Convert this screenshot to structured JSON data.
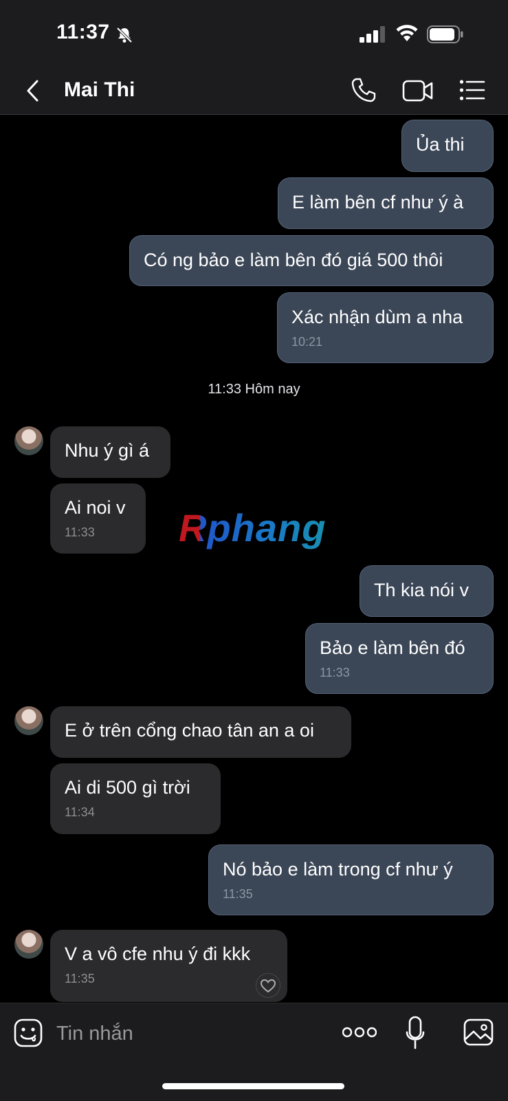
{
  "status_bar": {
    "time": "11:37",
    "battery_level": 0.9
  },
  "header": {
    "title": "Mai Thi"
  },
  "date_separator": "11:33 Hôm nay",
  "messages": [
    {
      "dir": "out",
      "text": "Ủa thi"
    },
    {
      "dir": "out",
      "text": "E làm bên cf như ý à"
    },
    {
      "dir": "out",
      "text": "Có ng bảo e làm bên đó giá 500 thôi"
    },
    {
      "dir": "out",
      "text": "Xác nhận dùm a nha",
      "time": "10:21"
    },
    {
      "dir": "in",
      "text": "Nhu ý gì á"
    },
    {
      "dir": "in",
      "text": "Ai noi v",
      "time": "11:33"
    },
    {
      "dir": "out",
      "text": "Th kia nói v"
    },
    {
      "dir": "out",
      "text": "Bảo e làm bên đó",
      "time": "11:33"
    },
    {
      "dir": "in",
      "text": "E ở trên cổng chao tân an a oi"
    },
    {
      "dir": "in",
      "text": "Ai di 500 gì trời",
      "time": "11:34"
    },
    {
      "dir": "out",
      "text": "Nó bảo e làm trong cf như ý",
      "time": "11:35"
    },
    {
      "dir": "in",
      "text": "V a vô cfe nhu ý đi kkk",
      "time": "11:35"
    }
  ],
  "watermark": "Rphang",
  "composer": {
    "placeholder": "Tin nhắn"
  },
  "colors": {
    "outgoing_bubble": "#3b4656",
    "incoming_bubble": "#2b2b2d",
    "background": "#000000"
  }
}
